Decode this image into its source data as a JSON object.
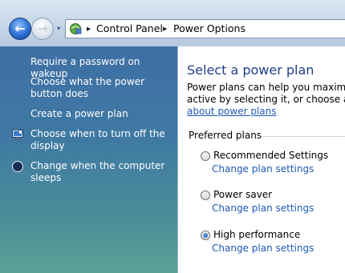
{
  "nav": {
    "back_icon": "back-arrow-icon",
    "forward_icon": "forward-arrow-icon",
    "back_glyph": "←",
    "forward_glyph": "→",
    "dropdown_glyph": "▾"
  },
  "address": {
    "icon": "control-panel-icon",
    "separator": "▶",
    "crumbs": [
      "Control Panel",
      "Power Options"
    ]
  },
  "sidebar": {
    "items": [
      {
        "label": "Require a password on wakeup",
        "icon": null
      },
      {
        "label": "Choose what the power button does",
        "icon": null
      },
      {
        "label": "Create a power plan",
        "icon": null
      },
      {
        "label": "Choose when to turn off the display",
        "icon": "display-icon"
      },
      {
        "label": "Change when the computer sleeps",
        "icon": "moon-icon"
      }
    ]
  },
  "main": {
    "title": "Select a power plan",
    "desc_line1": "Power plans can help you maximize y",
    "desc_line2": "active by selecting it, or choose a plar",
    "about_link": "about power plans",
    "section_label": "Preferred plans",
    "plans": [
      {
        "name": "Recommended Settings",
        "link": "Change plan settings",
        "selected": false
      },
      {
        "name": "Power saver",
        "link": "Change plan settings",
        "selected": false
      },
      {
        "name": "High performance",
        "link": "Change plan settings",
        "selected": true
      }
    ]
  },
  "colors": {
    "title": "#1e3f8a",
    "link": "#1f58b8",
    "sidebar_top": "#3f6fa4",
    "sidebar_bottom": "#5ca095"
  }
}
